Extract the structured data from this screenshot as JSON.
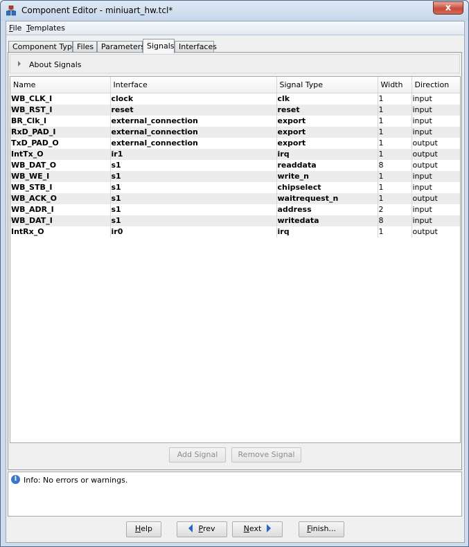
{
  "window": {
    "title": "Component Editor - miniuart_hw.tcl*",
    "close_glyph": "x"
  },
  "menu": {
    "items": [
      {
        "mnemonic": "F",
        "rest": "ile"
      },
      {
        "mnemonic": "T",
        "rest": "emplates"
      }
    ]
  },
  "tabs": [
    "Component Type",
    "Files",
    "Parameters",
    "Signals",
    "Interfaces"
  ],
  "active_tab": "Signals",
  "about": {
    "label": "About Signals"
  },
  "table": {
    "columns": [
      "Name",
      "Interface",
      "Signal Type",
      "Width",
      "Direction"
    ],
    "rows": [
      [
        "WB_CLK_I",
        "clock",
        "clk",
        "1",
        "input"
      ],
      [
        "WB_RST_I",
        "reset",
        "reset",
        "1",
        "input"
      ],
      [
        "BR_Clk_I",
        "external_connection",
        "export",
        "1",
        "input"
      ],
      [
        "RxD_PAD_I",
        "external_connection",
        "export",
        "1",
        "input"
      ],
      [
        "TxD_PAD_O",
        "external_connection",
        "export",
        "1",
        "output"
      ],
      [
        "IntTx_O",
        "ir1",
        "irq",
        "1",
        "output"
      ],
      [
        "WB_DAT_O",
        "s1",
        "readdata",
        "8",
        "output"
      ],
      [
        "WB_WE_I",
        "s1",
        "write_n",
        "1",
        "input"
      ],
      [
        "WB_STB_I",
        "s1",
        "chipselect",
        "1",
        "input"
      ],
      [
        "WB_ACK_O",
        "s1",
        "waitrequest_n",
        "1",
        "output"
      ],
      [
        "WB_ADR_I",
        "s1",
        "address",
        "2",
        "input"
      ],
      [
        "WB_DAT_I",
        "s1",
        "writedata",
        "8",
        "input"
      ],
      [
        "IntRx_O",
        "ir0",
        "irq",
        "1",
        "output"
      ]
    ]
  },
  "buttons": {
    "add_signal": "Add Signal",
    "remove_signal": "Remove Signal"
  },
  "messages": {
    "info_icon_letter": "i",
    "text": "Info: No errors or warnings."
  },
  "nav": {
    "help": {
      "mnemonic": "H",
      "rest": "elp"
    },
    "prev": {
      "mnemonic": "P",
      "rest": "rev"
    },
    "next": {
      "mnemonic": "N",
      "rest": "ext"
    },
    "finish": {
      "mnemonic": "F",
      "rest": "inish..."
    }
  }
}
